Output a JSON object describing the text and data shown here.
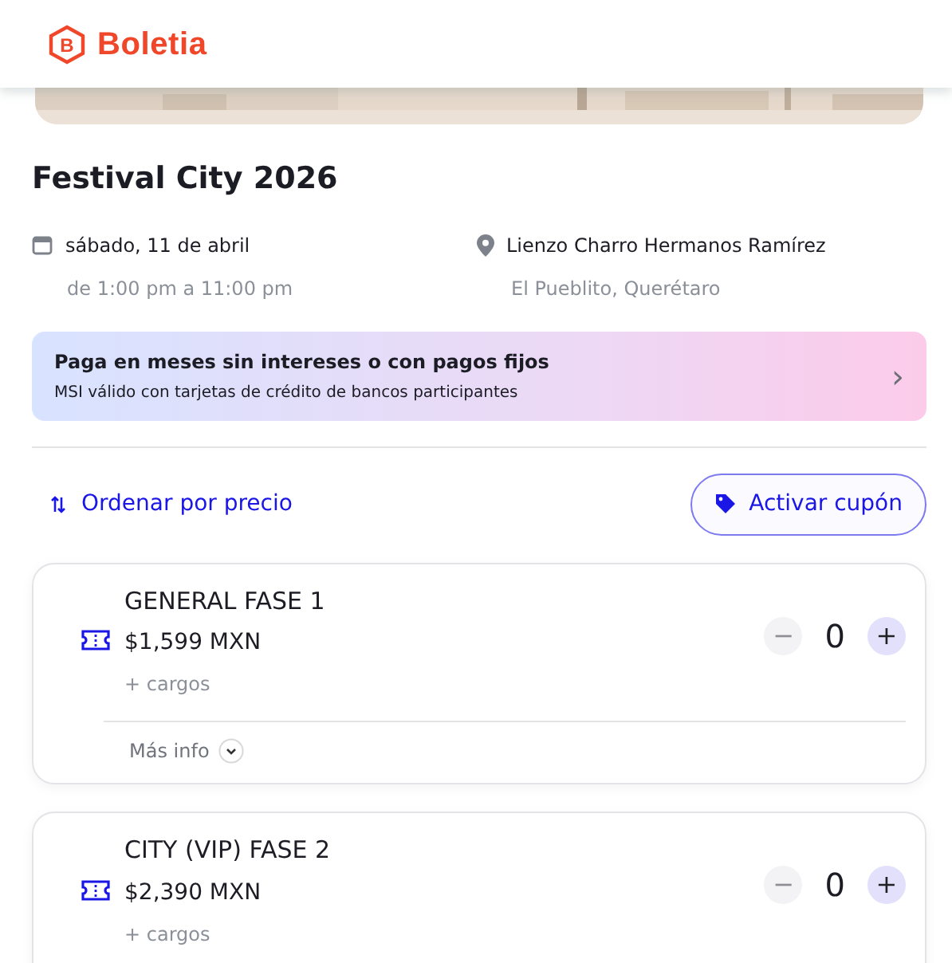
{
  "header": {
    "logo_letter": "B",
    "brand": "Boletia"
  },
  "event": {
    "title": "Festival City 2026",
    "date": "sábado, 11 de abril",
    "time": "de 1:00 pm a 11:00 pm",
    "venue": "Lienzo Charro Hermanos Ramírez",
    "place": "El Pueblito, Querétaro"
  },
  "payment_promo": {
    "title": "Paga en meses sin intereses o con pagos fijos",
    "subtitle": "MSI válido con tarjetas de crédito de bancos participantes",
    "arrow": "›"
  },
  "sort_link": "Ordenar por precio",
  "coupon_button": "Activar cupón",
  "tickets": [
    {
      "name": "GENERAL FASE 1",
      "price": "$1,599 MXN",
      "fees": "+ cargos",
      "quantity": "0",
      "minus": "−",
      "plus": "+",
      "minus_disabled": true,
      "more_info": "Más info"
    },
    {
      "name": "CITY (VIP) FASE 2",
      "price": "$2,390 MXN",
      "fees": "+ cargos",
      "quantity": "0",
      "minus": "−",
      "plus": "+",
      "minus_disabled": true
    }
  ]
}
